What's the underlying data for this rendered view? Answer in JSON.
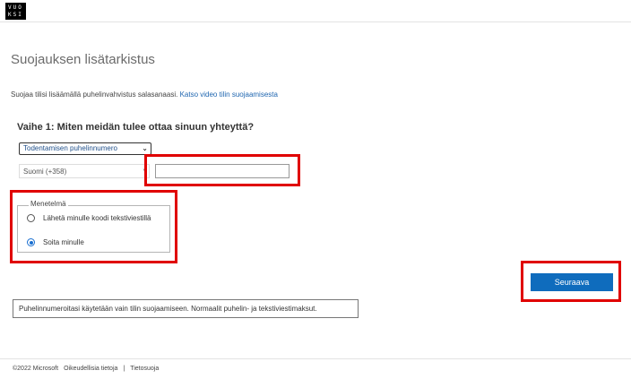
{
  "header": {
    "logo_line1": "VUO",
    "logo_line2": "KSI"
  },
  "page_title": "Suojauksen lisätarkistus",
  "intro": {
    "text": "Suojaa tilisi lisäämällä puhelinvahvistus salasanaasi.",
    "link": "Katso video tilin suojaamisesta"
  },
  "step_heading": "Vaihe 1: Miten meidän tulee ottaa sinuun yhteyttä?",
  "method_select": {
    "selected": "Todentamisen puhelinnumero"
  },
  "country_select": {
    "selected": "Suomi (+358)"
  },
  "phone_input": {
    "value": ""
  },
  "method_group": {
    "legend": "Menetelmä",
    "options": [
      {
        "label": "Lähetä minulle koodi tekstiviestillä",
        "checked": false
      },
      {
        "label": "Soita minulle",
        "checked": true
      }
    ]
  },
  "next_button": "Seuraava",
  "info_text": "Puhelinnumeroitasi käytetään vain tilin suojaamiseen. Normaalit puhelin- ja tekstiviestimaksut.",
  "footer": {
    "copyright": "©2022 Microsoft",
    "legal": "Oikeudellisia tietoja",
    "separator": "|",
    "privacy": "Tietosuoja"
  },
  "colors": {
    "accent": "#0f6cbd",
    "link": "#1f66b0",
    "highlight": "#e00000"
  }
}
